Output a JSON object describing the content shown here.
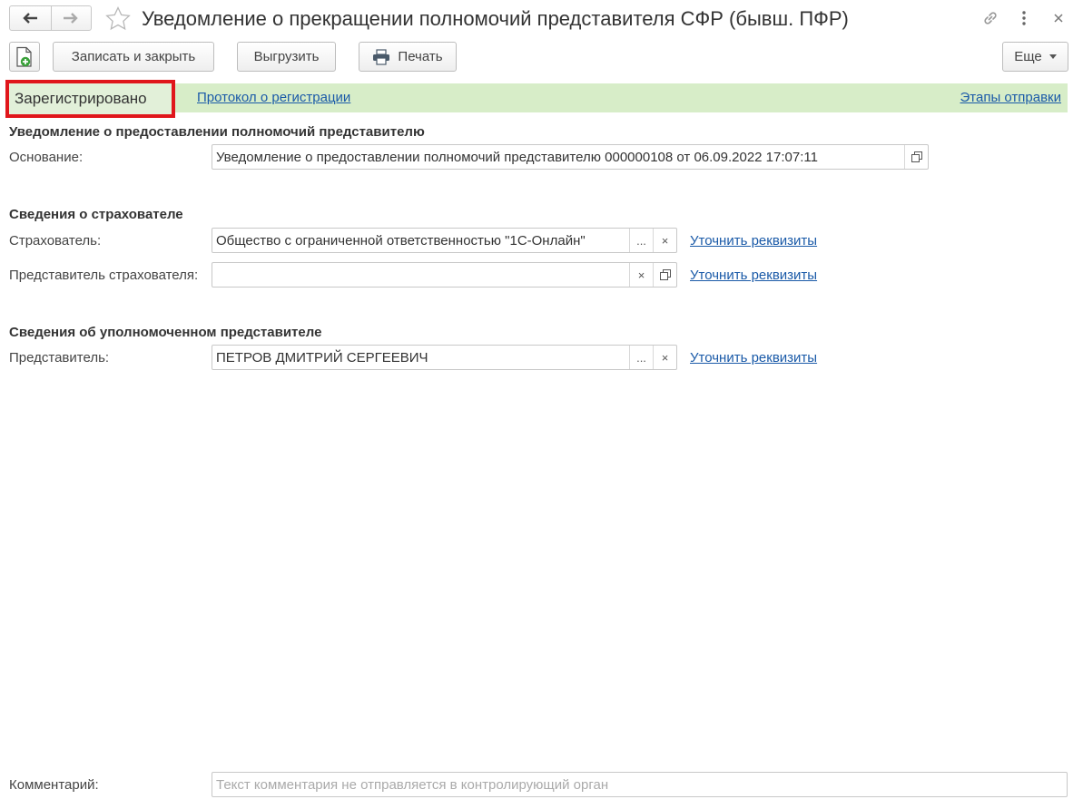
{
  "title": "Уведомление о прекращении полномочий представителя СФР (бывш. ПФР)",
  "colors": {
    "status_bg": "#d7edc8",
    "highlight_border": "#e0161b",
    "link": "#1a5aa8"
  },
  "toolbar": {
    "save_close_label": "Записать и закрыть",
    "export_label": "Выгрузить",
    "print_label": "Печать",
    "more_label": "Еще"
  },
  "status": {
    "label": "Зарегистрировано",
    "protocol_link": "Протокол о регистрации",
    "stages_link": "Этапы отправки"
  },
  "section_notice": {
    "title": "Уведомление о предоставлении полномочий представителю",
    "basis_label": "Основание:",
    "basis_value": "Уведомление о предоставлении полномочий представителю 000000108 от 06.09.2022 17:07:11"
  },
  "section_insurer": {
    "title": "Сведения о страхователе",
    "insurer_label": "Страхователь:",
    "insurer_value": "Общество с ограниченной ответственностью \"1С-Онлайн\"",
    "insurer_link": "Уточнить реквизиты",
    "rep_label": "Представитель страхователя:",
    "rep_value": "",
    "rep_link": "Уточнить реквизиты"
  },
  "section_agent": {
    "title": "Сведения об уполномоченном представителе",
    "agent_label": "Представитель:",
    "agent_value": "ПЕТРОВ ДМИТРИЙ СЕРГЕЕВИЧ",
    "agent_link": "Уточнить реквизиты"
  },
  "comment": {
    "label": "Комментарий:",
    "placeholder": "Текст комментария не отправляется в контролирующий орган"
  },
  "field_buttons": {
    "select": "...",
    "clear": "×"
  }
}
